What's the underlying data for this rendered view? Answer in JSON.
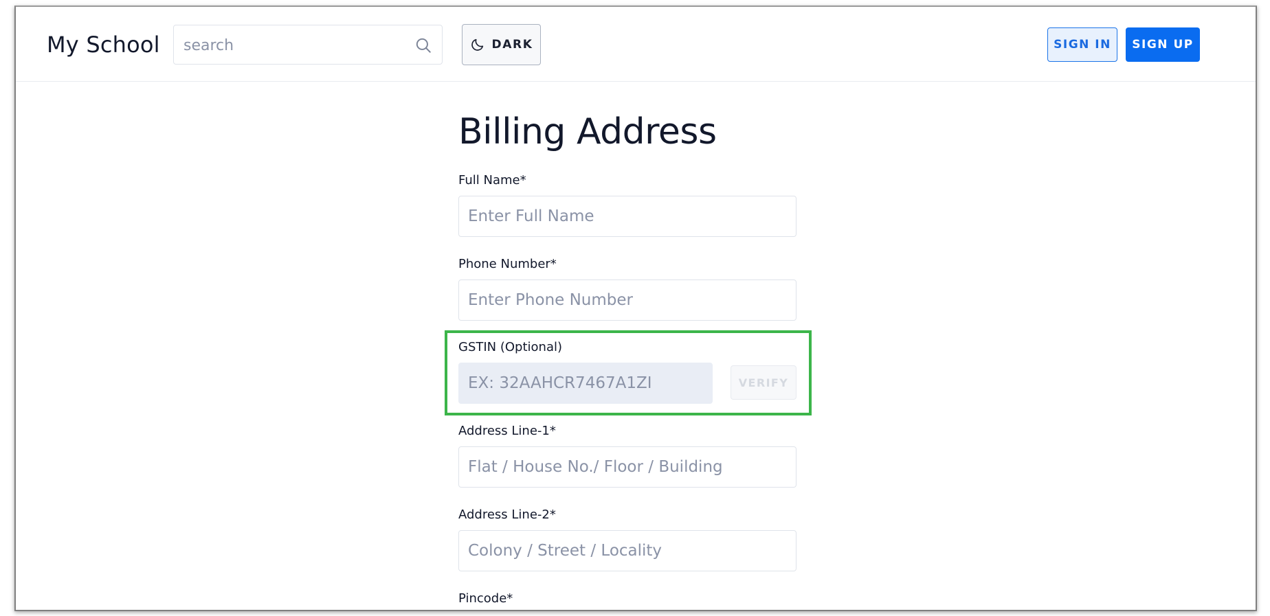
{
  "header": {
    "brand": "My School",
    "search": {
      "placeholder": "search",
      "value": ""
    },
    "theme_toggle": {
      "label": "DARK",
      "icon": "moon-icon"
    },
    "sign_in_label": "SIGN IN",
    "sign_up_label": "SIGN UP"
  },
  "form": {
    "title": "Billing Address",
    "fields": [
      {
        "label": "Full Name*",
        "placeholder": "Enter Full Name",
        "value": ""
      },
      {
        "label": "Phone Number*",
        "placeholder": "Enter Phone Number",
        "value": ""
      },
      {
        "label": "GSTIN (Optional)",
        "placeholder": "EX: 32AAHCR7467A1ZI",
        "value": "",
        "action_label": "VERIFY",
        "action_enabled": false
      },
      {
        "label": "Address Line-1*",
        "placeholder": "Flat / House No./ Floor / Building",
        "value": ""
      },
      {
        "label": "Address Line-2*",
        "placeholder": "Colony / Street / Locality",
        "value": ""
      },
      {
        "label": "Pincode*"
      }
    ]
  },
  "colors": {
    "primary": "#0a6cf0",
    "highlight": "#3cb54a",
    "disabled_field_bg": "#e9edf5",
    "text_dark": "#12182b",
    "placeholder": "#8a92a6"
  }
}
